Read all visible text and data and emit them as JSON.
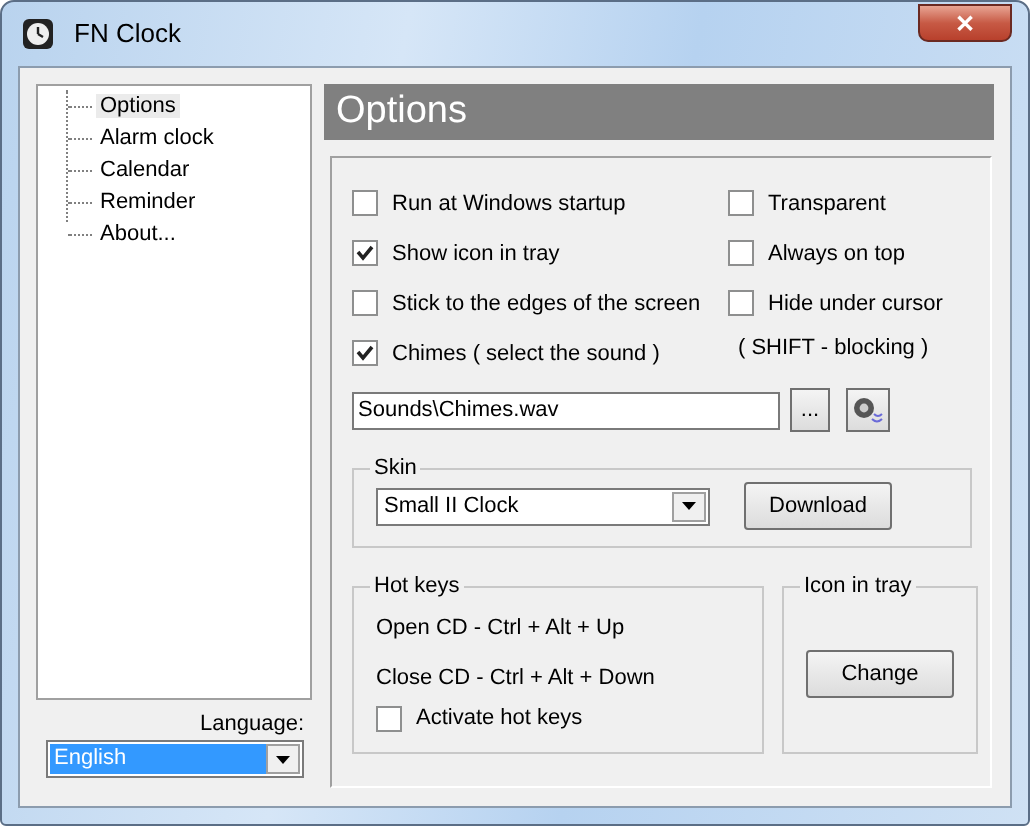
{
  "window": {
    "title": "FN Clock",
    "close": "✕"
  },
  "tree": {
    "items": [
      {
        "label": "Options",
        "selected": true
      },
      {
        "label": "Alarm clock",
        "selected": false
      },
      {
        "label": "Calendar",
        "selected": false
      },
      {
        "label": "Reminder",
        "selected": false
      },
      {
        "label": "About...",
        "selected": false
      }
    ]
  },
  "language": {
    "label": "Language:",
    "value": "English"
  },
  "header": "Options",
  "options_left": [
    {
      "label": "Run at Windows startup",
      "checked": false
    },
    {
      "label": "Show icon in tray",
      "checked": true
    },
    {
      "label": "Stick to the edges of the screen",
      "checked": false
    },
    {
      "label": "Chimes ( select the sound )",
      "checked": true
    }
  ],
  "options_right": [
    {
      "label": "Transparent",
      "checked": false
    },
    {
      "label": "Always on top",
      "checked": false
    },
    {
      "label": "Hide under cursor",
      "checked": false
    }
  ],
  "note": "( SHIFT - blocking )",
  "sound": {
    "value": "Sounds\\Chimes.wav",
    "browse": "..."
  },
  "skin": {
    "title": "Skin",
    "value": "Small II Clock",
    "button": "Download"
  },
  "hot_keys": {
    "title": "Hot keys",
    "lines": [
      "Open CD - Ctrl + Alt + Up",
      "Close CD - Ctrl + Alt + Down"
    ],
    "activate": {
      "label": "Activate hot keys",
      "checked": false
    }
  },
  "tray_icon": {
    "title": "Icon in tray",
    "button": "Change"
  }
}
